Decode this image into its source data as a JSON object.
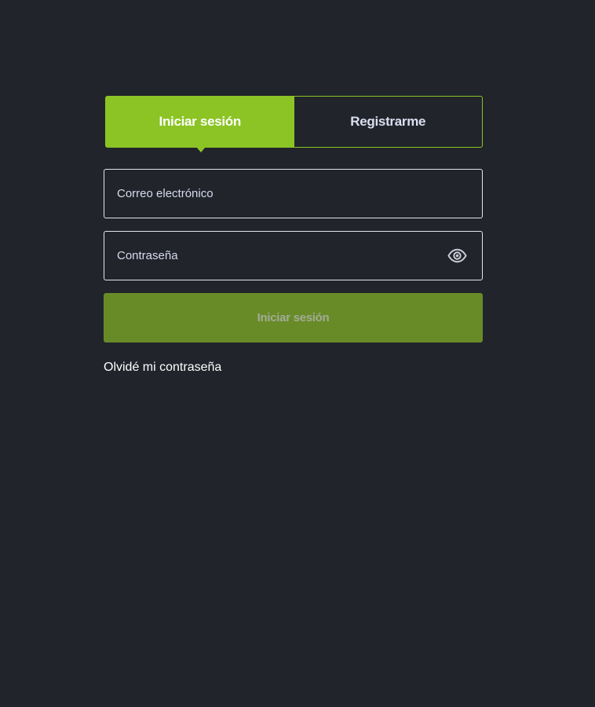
{
  "tabs": {
    "login_label": "Iniciar sesión",
    "register_label": "Registrarme"
  },
  "form": {
    "email_placeholder": "Correo electrónico",
    "email_value": "",
    "password_placeholder": "Contraseña",
    "password_value": "",
    "password_toggle_icon": "eye-icon",
    "submit_label": "Iniciar sesión",
    "submit_disabled": true
  },
  "links": {
    "forgot_password": "Olvidé mi contraseña"
  },
  "colors": {
    "background": "#21242b",
    "accent": "#8cc425",
    "submit_disabled_bg": "#688b27",
    "field_border": "#e4e6ee"
  }
}
